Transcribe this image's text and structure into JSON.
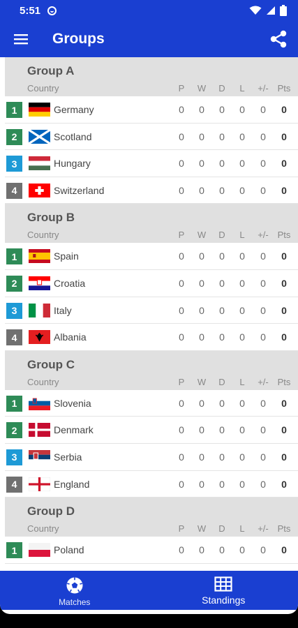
{
  "status": {
    "time": "5:51"
  },
  "app": {
    "title": "Groups"
  },
  "columns": {
    "country": "Country",
    "p": "P",
    "w": "W",
    "d": "D",
    "l": "L",
    "gd": "+/-",
    "pts": "Pts"
  },
  "colors": {
    "primary": "#1a3fd1",
    "pos1": "#2e8b57",
    "pos2": "#2e8b57",
    "pos3": "#1e9ad6",
    "pos4": "#707070"
  },
  "groups": [
    {
      "name": "Group A",
      "teams": [
        {
          "pos": "1",
          "name": "Germany",
          "flag": "germany-flag",
          "p": "0",
          "w": "0",
          "d": "0",
          "l": "0",
          "gd": "0",
          "pts": "0"
        },
        {
          "pos": "2",
          "name": "Scotland",
          "flag": "scotland-flag",
          "p": "0",
          "w": "0",
          "d": "0",
          "l": "0",
          "gd": "0",
          "pts": "0"
        },
        {
          "pos": "3",
          "name": "Hungary",
          "flag": "hungary-flag",
          "p": "0",
          "w": "0",
          "d": "0",
          "l": "0",
          "gd": "0",
          "pts": "0"
        },
        {
          "pos": "4",
          "name": "Switzerland",
          "flag": "switzerland-flag",
          "p": "0",
          "w": "0",
          "d": "0",
          "l": "0",
          "gd": "0",
          "pts": "0"
        }
      ]
    },
    {
      "name": "Group B",
      "teams": [
        {
          "pos": "1",
          "name": "Spain",
          "flag": "spain-flag",
          "p": "0",
          "w": "0",
          "d": "0",
          "l": "0",
          "gd": "0",
          "pts": "0"
        },
        {
          "pos": "2",
          "name": "Croatia",
          "flag": "croatia-flag",
          "p": "0",
          "w": "0",
          "d": "0",
          "l": "0",
          "gd": "0",
          "pts": "0"
        },
        {
          "pos": "3",
          "name": "Italy",
          "flag": "italy-flag",
          "p": "0",
          "w": "0",
          "d": "0",
          "l": "0",
          "gd": "0",
          "pts": "0"
        },
        {
          "pos": "4",
          "name": "Albania",
          "flag": "albania-flag",
          "p": "0",
          "w": "0",
          "d": "0",
          "l": "0",
          "gd": "0",
          "pts": "0"
        }
      ]
    },
    {
      "name": "Group C",
      "teams": [
        {
          "pos": "1",
          "name": "Slovenia",
          "flag": "slovenia-flag",
          "p": "0",
          "w": "0",
          "d": "0",
          "l": "0",
          "gd": "0",
          "pts": "0"
        },
        {
          "pos": "2",
          "name": "Denmark",
          "flag": "denmark-flag",
          "p": "0",
          "w": "0",
          "d": "0",
          "l": "0",
          "gd": "0",
          "pts": "0"
        },
        {
          "pos": "3",
          "name": "Serbia",
          "flag": "serbia-flag",
          "p": "0",
          "w": "0",
          "d": "0",
          "l": "0",
          "gd": "0",
          "pts": "0"
        },
        {
          "pos": "4",
          "name": "England",
          "flag": "england-flag",
          "p": "0",
          "w": "0",
          "d": "0",
          "l": "0",
          "gd": "0",
          "pts": "0"
        }
      ]
    },
    {
      "name": "Group D",
      "teams": [
        {
          "pos": "1",
          "name": "Poland",
          "flag": "poland-flag",
          "p": "0",
          "w": "0",
          "d": "0",
          "l": "0",
          "gd": "0",
          "pts": "0"
        }
      ]
    }
  ],
  "nav": {
    "matches": "Matches",
    "standings": "Standings"
  }
}
